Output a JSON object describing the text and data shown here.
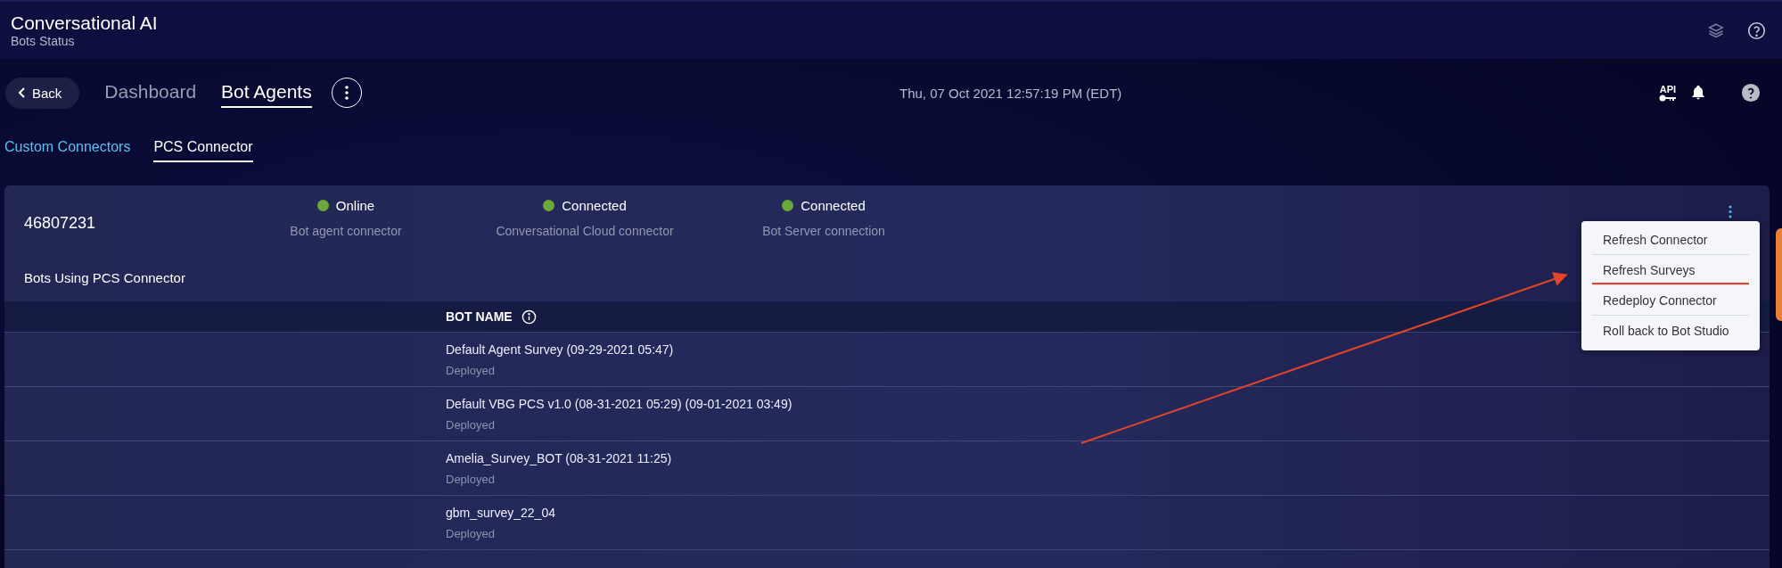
{
  "app_header": {
    "title": "Conversational AI",
    "subtitle": "Bots Status"
  },
  "nav": {
    "back": "Back",
    "tabs": [
      {
        "label": "Dashboard",
        "selected": false
      },
      {
        "label": "Bot Agents",
        "selected": true
      }
    ],
    "datetime": "Thu, 07 Oct 2021 12:57:19 PM (EDT)",
    "api_label": "API"
  },
  "sub_tabs": [
    {
      "label": "Custom Connectors",
      "selected": false
    },
    {
      "label": "PCS Connector",
      "selected": true
    }
  ],
  "connector": {
    "id": "46807231",
    "statuses": [
      {
        "value": "Online",
        "label": "Bot agent connector",
        "color": "#6aa83a"
      },
      {
        "value": "Connected",
        "label": "Conversational Cloud connector",
        "color": "#6aa83a"
      },
      {
        "value": "Connected",
        "label": "Bot Server connection",
        "color": "#6aa83a"
      }
    ],
    "bots_heading": "Bots Using PCS Connector",
    "table": {
      "columns": [
        "BOT NAME"
      ],
      "rows": [
        {
          "name": "Default Agent Survey (09-29-2021 05:47)",
          "status": "Deployed"
        },
        {
          "name": "Default VBG PCS v1.0 (08-31-2021 05:29) (09-01-2021 03:49)",
          "status": "Deployed"
        },
        {
          "name": "Amelia_Survey_BOT (08-31-2021 11:25)",
          "status": "Deployed"
        },
        {
          "name": "gbm_survey_22_04",
          "status": "Deployed"
        }
      ]
    }
  },
  "menu": {
    "items": [
      {
        "label": "Refresh Connector",
        "highlighted": false
      },
      {
        "label": "Refresh Surveys",
        "highlighted": true
      },
      {
        "label": "Redeploy Connector",
        "highlighted": false
      },
      {
        "label": "Roll back to Bot Studio",
        "highlighted": false
      }
    ]
  }
}
